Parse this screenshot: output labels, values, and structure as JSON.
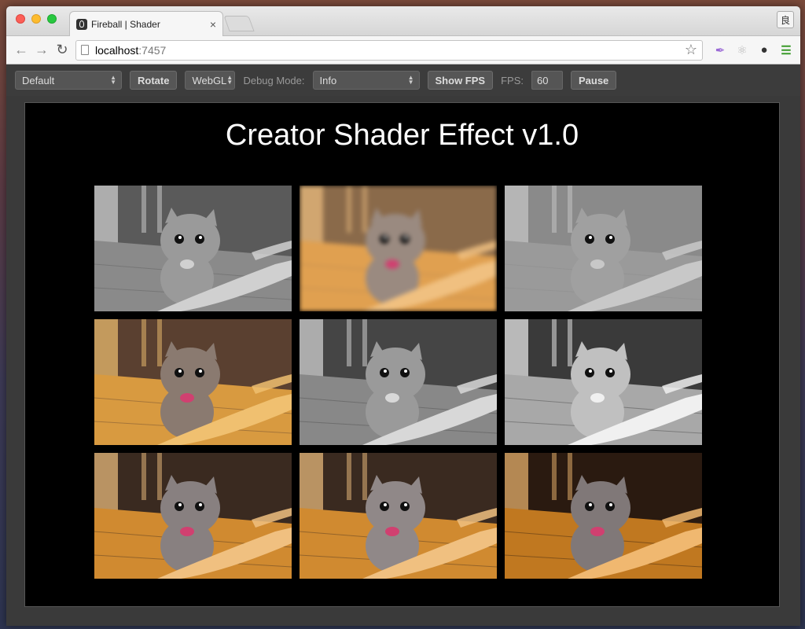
{
  "browser": {
    "tab_title": "Fireball | Shader",
    "tab_close": "×",
    "url_host": "localhost",
    "url_port": ":7457",
    "profile_label": "良"
  },
  "app_toolbar": {
    "scene_select": "Default",
    "rotate_label": "Rotate",
    "renderer_select": "WebGL",
    "debug_mode_label": "Debug Mode:",
    "debug_mode_select": "Info",
    "show_fps_label": "Show FPS",
    "fps_label": "FPS:",
    "fps_value": "60",
    "pause_label": "Pause"
  },
  "canvas": {
    "title": "Creator Shader Effect v1.0"
  },
  "tiles": [
    {
      "effect": "grayscale",
      "bg": "#5a5a5a",
      "floor": "#8a8a8a",
      "cat": "#9a9a9a",
      "accent": "#d0d0d0"
    },
    {
      "effect": "blur",
      "bg": "#8a6a4a",
      "floor": "#e0a050",
      "cat": "#9a8a80",
      "accent": "#f0c080"
    },
    {
      "effect": "emboss",
      "bg": "#8a8a8a",
      "floor": "#9a9a9a",
      "cat": "#a0a0a0",
      "accent": "#c8c8c8"
    },
    {
      "effect": "mosaic",
      "bg": "#5a4030",
      "floor": "#d89a40",
      "cat": "#8a7a70",
      "accent": "#f0c070"
    },
    {
      "effect": "grayscale",
      "bg": "#454545",
      "floor": "#888888",
      "cat": "#9a9a9a",
      "accent": "#d8d8d8"
    },
    {
      "effect": "high-contrast",
      "bg": "#3a3a3a",
      "floor": "#a8a8a8",
      "cat": "#c0c0c0",
      "accent": "#f0f0f0"
    },
    {
      "effect": "normal",
      "bg": "#3a2a20",
      "floor": "#d08a30",
      "cat": "#888080",
      "accent": "#f0c080"
    },
    {
      "effect": "normal",
      "bg": "#3a2a20",
      "floor": "#d08a30",
      "cat": "#908888",
      "accent": "#f0c080"
    },
    {
      "effect": "normal",
      "bg": "#2a1a10",
      "floor": "#c07820",
      "cat": "#807878",
      "accent": "#f0b870"
    }
  ]
}
